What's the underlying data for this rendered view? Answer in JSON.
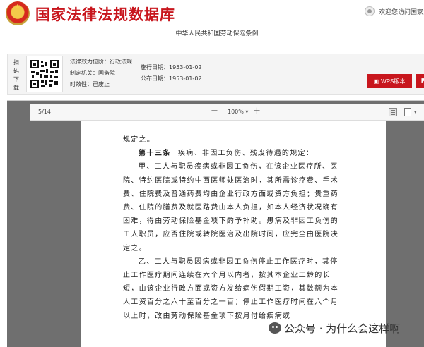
{
  "header": {
    "site_title": "国家法律法规数据库",
    "welcome": "欢迎您访问国家法律法规数据库"
  },
  "document": {
    "title": "中华人民共和国劳动保险条例"
  },
  "info": {
    "scan_label": "扫码下载",
    "effect_level_label": "法律效力位阶：",
    "effect_level_value": "行政法规",
    "issuer_label": "制定机关：",
    "issuer_value": "国务院",
    "validity_label": "时效性：",
    "validity_value": "已废止",
    "effective_date_label": "施行日期：",
    "effective_date_value": "1953-01-02",
    "publish_date_label": "公布日期：",
    "publish_date_value": "1953-01-02",
    "wps_button": "WPS版本",
    "wps_icon": "document-icon",
    "extra_icon": "pdf-icon"
  },
  "viewer": {
    "page_indicator": "5/14",
    "zoom_out": "−",
    "zoom_level": "100%",
    "zoom_caret": "▾",
    "zoom_in": "+",
    "icons": [
      "sidebar-toggle-icon",
      "page-view-icon"
    ]
  },
  "page_content": {
    "line_0": "规定之。",
    "article_no": "第十三条",
    "article_title": "疾病、非因工负伤、残废待遇的规定：",
    "para_1": "甲、工人与职员疾病或非因工负伤，在该企业医疗所、医院、特约医院或特约中西医师处医治时，其所需诊疗费、手术费、住院费及普通药费均由企业行政方面或资方负担；贵重药费、住院的膳费及就医路费由本人负担，如本人经济状况确有困难，得由劳动保险基金项下酌予补助。患病及非因工负伤的工人职员，应否住院或转院医治及出院时间，应完全由医院决定之。",
    "para_2": "乙、工人与职员因病或非因工负伤停止工作医疗时，其停止工作医疗期间连续在六个月以内者，按其本企业工龄的长短，由该企业行政方面或资方发给病伤假期工资，其数额为本人工资百分之六十至百分之一百；停止工作医疗时间在六个月以上时，改由劳动保险基金项下按月付给疾病或"
  },
  "watermark": {
    "text": "公众号 · 为什么会这样啊",
    "icon": "wechat-icon"
  }
}
